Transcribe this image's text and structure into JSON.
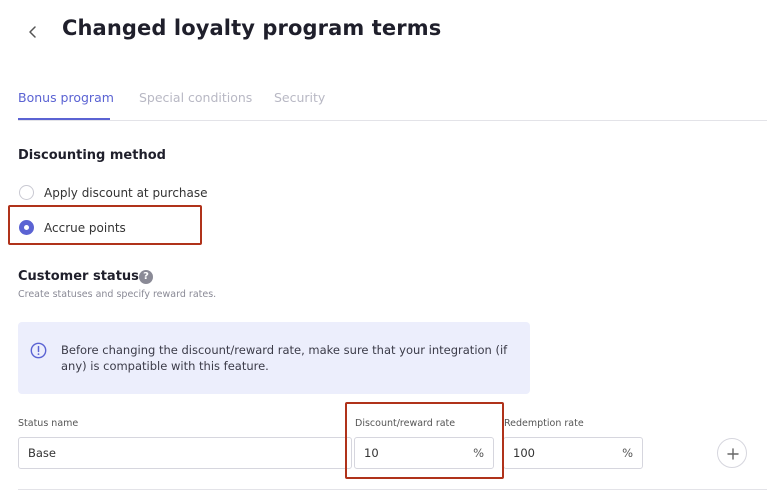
{
  "header": {
    "title": "Changed loyalty program terms",
    "back_icon": "chevron-left-icon"
  },
  "tabs": [
    {
      "label": "Bonus program",
      "active": true
    },
    {
      "label": "Special conditions",
      "active": false
    },
    {
      "label": "Security",
      "active": false
    }
  ],
  "discounting": {
    "title": "Discounting method",
    "options": [
      {
        "label": "Apply discount at purchase",
        "selected": false
      },
      {
        "label": "Accrue points",
        "selected": true
      }
    ]
  },
  "customer_status": {
    "title": "Customer status",
    "help_icon": "question-icon",
    "help_glyph": "?",
    "subtitle": "Create statuses and specify reward rates."
  },
  "info_banner": {
    "icon": "info-icon",
    "text": "Before changing the discount/reward rate, make sure that your integration (if any) is compatible with this feature."
  },
  "status_row": {
    "status_name_label": "Status name",
    "status_name_value": "Base",
    "discount_rate_label": "Discount/reward rate",
    "discount_rate_value": "10",
    "discount_rate_suffix": "%",
    "redemption_rate_label": "Redemption rate",
    "redemption_rate_value": "100",
    "redemption_rate_suffix": "%",
    "add_icon": "plus-icon"
  },
  "colors": {
    "accent": "#5b63d3",
    "highlight_box": "#b0321a",
    "info_background": "#eceefc"
  }
}
